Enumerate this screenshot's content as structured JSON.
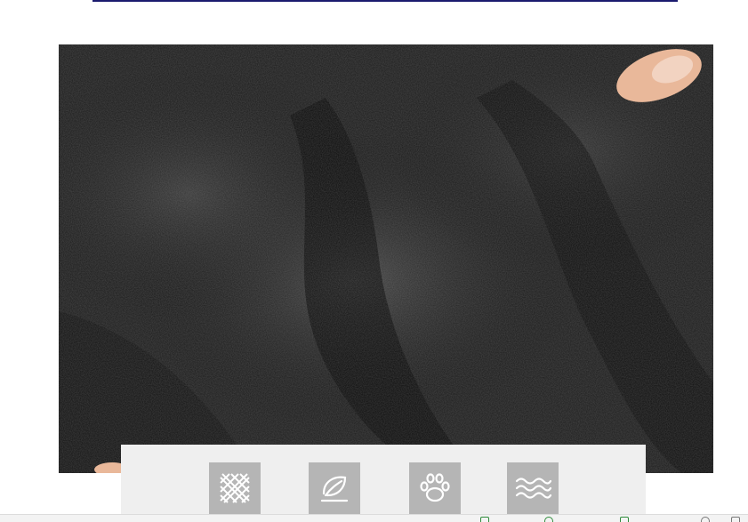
{
  "page": {
    "accent_line_color": "#1a1a6e",
    "photo": {
      "subject": "black-pebbled-leather-icon"
    },
    "features": {
      "icons": [
        "mesh-grid-icon",
        "leaf-icon",
        "paw-icon",
        "waves-icon"
      ],
      "icon_bg": "#b5b5b5",
      "bar_bg": "#efefef"
    }
  },
  "taskbar": {
    "items": [
      {
        "label": "",
        "icon": "play-icon"
      },
      {
        "label": "",
        "icon": "search-circle-icon"
      },
      {
        "label": "",
        "icon": "news-icon"
      },
      {
        "label": "",
        "icon": "settings-icon"
      },
      {
        "label": "",
        "icon": "edit-icon"
      }
    ]
  }
}
